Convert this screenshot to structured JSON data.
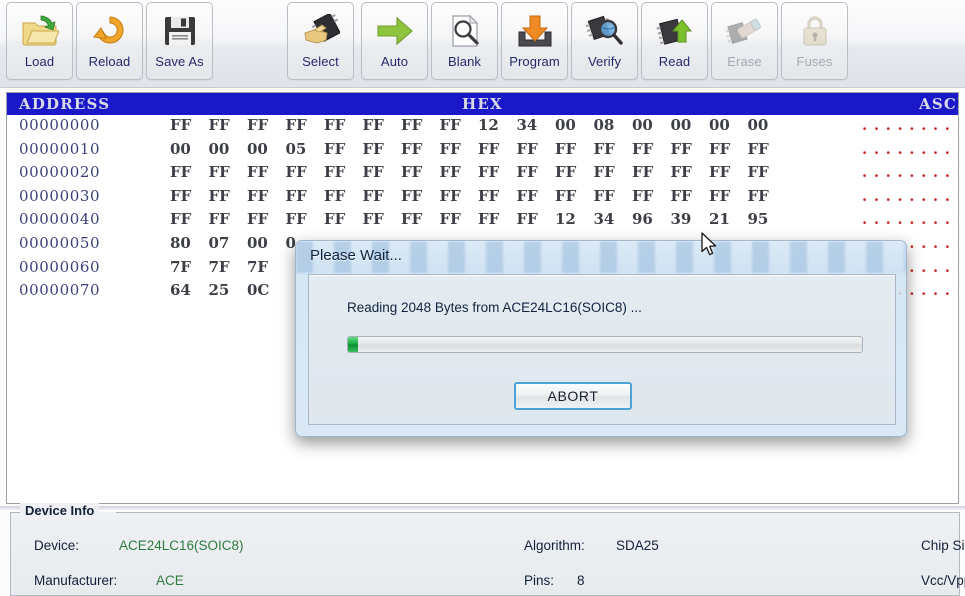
{
  "toolbar": {
    "buttons": [
      {
        "id": "load",
        "label": "Load",
        "icon": "folder-open-green-arrow-icon",
        "disabled": false,
        "gap_after": false
      },
      {
        "id": "reload",
        "label": "Reload",
        "icon": "orange-refresh-arrow-icon",
        "disabled": false,
        "gap_after": false
      },
      {
        "id": "saveas",
        "label": "Save As",
        "icon": "floppy-disk-icon",
        "disabled": false,
        "gap_after": true
      },
      {
        "id": "select",
        "label": "Select",
        "icon": "hand-pointing-chip-icon",
        "disabled": false,
        "gap_after": true
      },
      {
        "id": "auto",
        "label": "Auto",
        "icon": "green-right-arrow-icon",
        "disabled": false,
        "gap_after": false
      },
      {
        "id": "blank",
        "label": "Blank",
        "icon": "magnifier-blank-page-icon",
        "disabled": false,
        "gap_after": false
      },
      {
        "id": "program",
        "label": "Program",
        "icon": "orange-down-arrow-tray-icon",
        "disabled": false,
        "gap_after": false
      },
      {
        "id": "verify",
        "label": "Verify",
        "icon": "chip-magnifier-icon",
        "disabled": false,
        "gap_after": false
      },
      {
        "id": "read",
        "label": "Read",
        "icon": "chip-green-up-arrow-icon",
        "disabled": false,
        "gap_after": false
      },
      {
        "id": "erase",
        "label": "Erase",
        "icon": "chip-eraser-icon",
        "disabled": true,
        "gap_after": false
      },
      {
        "id": "fuses",
        "label": "Fuses",
        "icon": "padlock-icon",
        "disabled": true,
        "gap_after": false
      }
    ]
  },
  "hex_view": {
    "headers": {
      "address": "ADDRESS",
      "hex": "HEX",
      "ascii": "ASCII"
    },
    "ascii_placeholder": "................",
    "rows": [
      {
        "address": "00000000",
        "bytes": [
          "FF",
          "FF",
          "FF",
          "FF",
          "FF",
          "FF",
          "FF",
          "FF",
          "12",
          "34",
          "00",
          "08",
          "00",
          "00",
          "00",
          "00"
        ]
      },
      {
        "address": "00000010",
        "bytes": [
          "00",
          "00",
          "00",
          "05",
          "FF",
          "FF",
          "FF",
          "FF",
          "FF",
          "FF",
          "FF",
          "FF",
          "FF",
          "FF",
          "FF",
          "FF"
        ]
      },
      {
        "address": "00000020",
        "bytes": [
          "FF",
          "FF",
          "FF",
          "FF",
          "FF",
          "FF",
          "FF",
          "FF",
          "FF",
          "FF",
          "FF",
          "FF",
          "FF",
          "FF",
          "FF",
          "FF"
        ]
      },
      {
        "address": "00000030",
        "bytes": [
          "FF",
          "FF",
          "FF",
          "FF",
          "FF",
          "FF",
          "FF",
          "FF",
          "FF",
          "FF",
          "FF",
          "FF",
          "FF",
          "FF",
          "FF",
          "FF"
        ]
      },
      {
        "address": "00000040",
        "bytes": [
          "FF",
          "FF",
          "FF",
          "FF",
          "FF",
          "FF",
          "FF",
          "FF",
          "FF",
          "FF",
          "12",
          "34",
          "96",
          "39",
          "21",
          "95"
        ]
      },
      {
        "address": "00000050",
        "bytes": [
          "80",
          "07",
          "00",
          "0",
          "",
          "",
          "",
          "",
          "",
          "",
          "",
          "",
          "",
          "",
          "",
          ""
        ]
      },
      {
        "address": "00000060",
        "bytes": [
          "7F",
          "7F",
          "7F",
          "",
          "",
          "",
          "",
          "",
          "",
          "",
          "",
          "",
          "",
          "",
          "",
          ""
        ]
      },
      {
        "address": "00000070",
        "bytes": [
          "64",
          "25",
          "0C",
          "",
          "",
          "",
          "",
          "",
          "",
          "",
          "",
          "",
          "",
          "",
          "",
          ""
        ]
      }
    ]
  },
  "dialog": {
    "title": "Please Wait...",
    "message": "Reading 2048 Bytes from ACE24LC16(SOIC8) ...",
    "progress_percent": 2,
    "abort_label": "ABORT"
  },
  "device_info": {
    "legend": "Device Info",
    "device_label": "Device:",
    "device_value": "ACE24LC16(SOIC8)",
    "manufacturer_label": "Manufacturer:",
    "manufacturer_value": "ACE",
    "algorithm_label": "Algorithm:",
    "algorithm_value": "SDA25",
    "pins_label": "Pins:",
    "pins_value": "8",
    "chip_size_label": "Chip Size:",
    "vcc_vpp_label": "Vcc/Vpp:"
  },
  "colors": {
    "header_blue": "#1a18c8",
    "address_text": "#3c3f7a",
    "hex_text": "#3d3f46",
    "ascii_red": "#c82a2a",
    "progress_green": "#14a83e",
    "label_navy": "#26296b",
    "device_value_green": "#2f7a3f"
  }
}
